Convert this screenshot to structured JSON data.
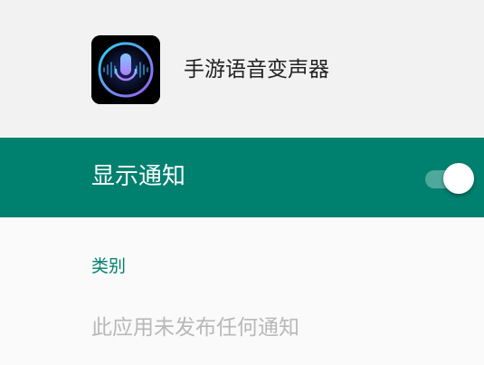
{
  "app": {
    "name": "手游语音变声器",
    "icon": "microphone-icon"
  },
  "notifications": {
    "label": "显示通知",
    "enabled": true
  },
  "categories": {
    "header": "类别",
    "empty_message": "此应用未发布任何通知"
  },
  "colors": {
    "accent": "#00806f",
    "header_bg": "#f2f2f2",
    "page_bg": "#fafafa",
    "muted_text": "#b8b8b8"
  }
}
